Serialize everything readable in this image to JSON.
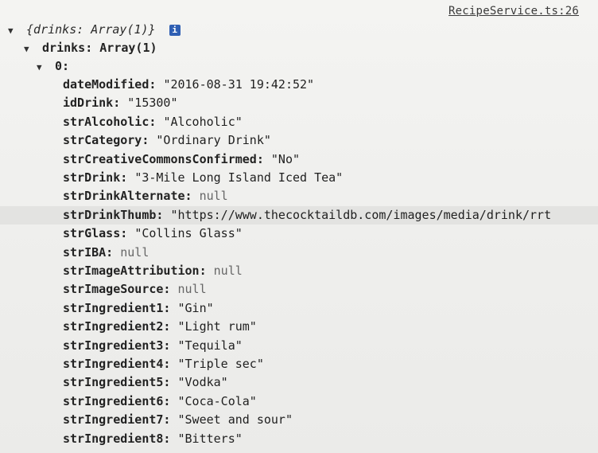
{
  "source": "RecipeService.ts:26",
  "root": {
    "summary": "{drinks: Array(1)}",
    "info_badge": "i",
    "drinks_label": "drinks: Array(1)",
    "index_label": "0:"
  },
  "properties": [
    {
      "key": "dateModified:",
      "value": "\"2016-08-31 19:42:52\"",
      "type": "string"
    },
    {
      "key": "idDrink:",
      "value": "\"15300\"",
      "type": "string"
    },
    {
      "key": "strAlcoholic:",
      "value": "\"Alcoholic\"",
      "type": "string"
    },
    {
      "key": "strCategory:",
      "value": "\"Ordinary Drink\"",
      "type": "string"
    },
    {
      "key": "strCreativeCommonsConfirmed:",
      "value": "\"No\"",
      "type": "string"
    },
    {
      "key": "strDrink:",
      "value": "\"3-Mile Long Island Iced Tea\"",
      "type": "string"
    },
    {
      "key": "strDrinkAlternate:",
      "value": "null",
      "type": "null"
    },
    {
      "key": "strDrinkThumb:",
      "value": "\"https://www.thecocktaildb.com/images/media/drink/rrt",
      "type": "string"
    },
    {
      "key": "strGlass:",
      "value": "\"Collins Glass\"",
      "type": "string"
    },
    {
      "key": "strIBA:",
      "value": "null",
      "type": "null"
    },
    {
      "key": "strImageAttribution:",
      "value": "null",
      "type": "null"
    },
    {
      "key": "strImageSource:",
      "value": "null",
      "type": "null"
    },
    {
      "key": "strIngredient1:",
      "value": "\"Gin\"",
      "type": "string"
    },
    {
      "key": "strIngredient2:",
      "value": "\"Light rum\"",
      "type": "string"
    },
    {
      "key": "strIngredient3:",
      "value": "\"Tequila\"",
      "type": "string"
    },
    {
      "key": "strIngredient4:",
      "value": "\"Triple sec\"",
      "type": "string"
    },
    {
      "key": "strIngredient5:",
      "value": "\"Vodka\"",
      "type": "string"
    },
    {
      "key": "strIngredient6:",
      "value": "\"Coca-Cola\"",
      "type": "string"
    },
    {
      "key": "strIngredient7:",
      "value": "\"Sweet and sour\"",
      "type": "string"
    },
    {
      "key": "strIngredient8:",
      "value": "\"Bitters\"",
      "type": "string"
    }
  ],
  "colors": {
    "background": "#f1f1ef",
    "highlight_row": "#e3e3e1",
    "info_badge": "#2f5fb3"
  },
  "icons": {
    "expand": "triangle-down-icon",
    "info": "info-icon"
  }
}
